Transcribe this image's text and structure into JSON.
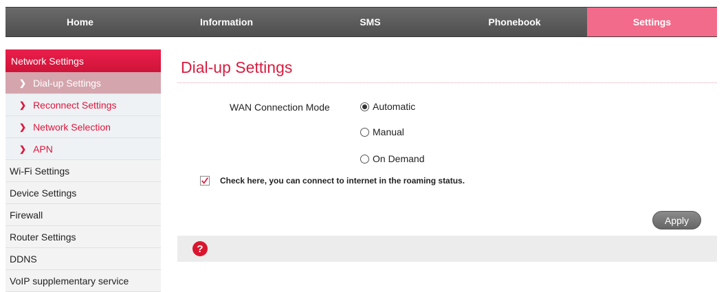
{
  "nav": {
    "items": [
      {
        "label": "Home",
        "active": false
      },
      {
        "label": "Information",
        "active": false
      },
      {
        "label": "SMS",
        "active": false
      },
      {
        "label": "Phonebook",
        "active": false
      },
      {
        "label": "Settings",
        "active": true
      }
    ],
    "active_color": "#f26b8a"
  },
  "sidebar": {
    "header": "Network Settings",
    "sub_items": [
      {
        "label": "Dial-up Settings",
        "active": true
      },
      {
        "label": "Reconnect Settings",
        "active": false
      },
      {
        "label": "Network Selection",
        "active": false
      },
      {
        "label": "APN",
        "active": false
      }
    ],
    "items": [
      {
        "label": "Wi-Fi Settings"
      },
      {
        "label": "Device Settings"
      },
      {
        "label": "Firewall"
      },
      {
        "label": "Router Settings"
      },
      {
        "label": "DDNS"
      },
      {
        "label": "VoIP supplementary service"
      }
    ]
  },
  "main": {
    "title": "Dial-up Settings",
    "wan_label": "WAN Connection Mode",
    "wan_options": [
      {
        "label": "Automatic",
        "selected": true
      },
      {
        "label": "Manual",
        "selected": false
      },
      {
        "label": "On Demand",
        "selected": false
      }
    ],
    "roaming": {
      "label": "Check here, you can connect to internet in the roaming status.",
      "checked": true
    },
    "apply_label": "Apply",
    "help_icon": "help-icon",
    "accent_color": "#d91c3f"
  }
}
